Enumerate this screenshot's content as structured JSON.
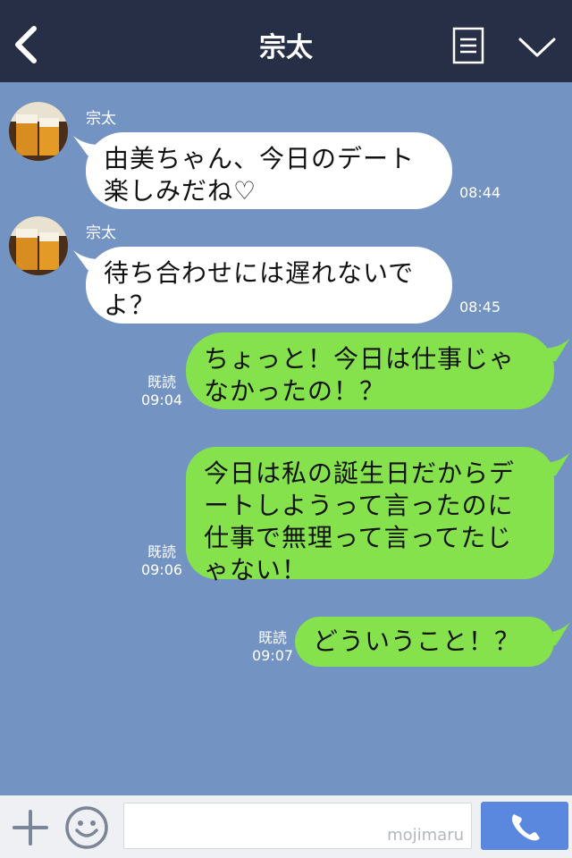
{
  "header": {
    "title": "宗太"
  },
  "messages": [
    {
      "direction": "in",
      "sender": "宗太",
      "text": "由美ちゃん、今日のデート\n楽しみだね♡",
      "time": "08:44"
    },
    {
      "direction": "in",
      "sender": "宗太",
      "text": "待ち合わせには遅れないで\nよ？",
      "time": "08:45"
    },
    {
      "direction": "out",
      "text": "ちょっと！今日は仕事じゃ\nなかったの！？",
      "read": "既読",
      "time": "09:04"
    },
    {
      "direction": "out",
      "text": "今日は私の誕生日だからデ\nートしようって言ったのに\n仕事で無理って言ってたじ\nゃない！",
      "read": "既読",
      "time": "09:06"
    },
    {
      "direction": "out",
      "text": "どういうこと！？",
      "read": "既読",
      "time": "09:07"
    }
  ],
  "footer": {
    "watermark": "mojimaru"
  },
  "colors": {
    "header_bg": "#262f45",
    "chat_bg": "#7393c2",
    "incoming_bubble": "#ffffff",
    "outgoing_bubble": "#85e24d",
    "call_button": "#5b88df"
  },
  "icons": {
    "back": "chevron-left-icon",
    "menu": "menu-icon",
    "collapse": "chevron-down-icon",
    "plus": "plus-icon",
    "emoji": "smiley-icon",
    "call": "phone-icon"
  }
}
